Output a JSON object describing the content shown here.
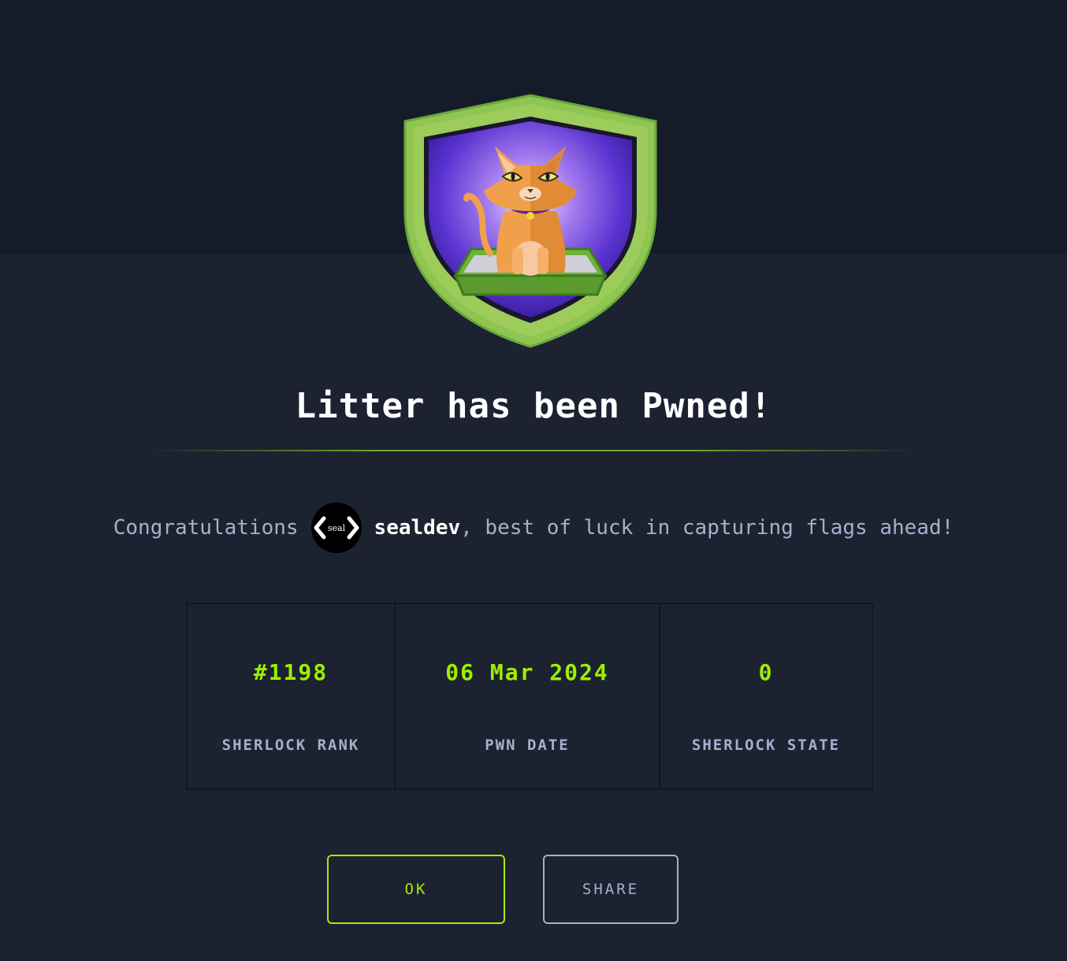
{
  "header": {
    "badge_icon": "litter-cat-shield-badge-icon"
  },
  "title": "Litter has been Pwned!",
  "congrats": {
    "prefix": "Congratulations",
    "avatar_text": "seal",
    "username": "sealdev",
    "suffix": ", best of luck in capturing flags ahead!"
  },
  "stats": [
    {
      "value": "#1198",
      "label": "SHERLOCK RANK"
    },
    {
      "value": "06 Mar 2024",
      "label": "PWN DATE"
    },
    {
      "value": "0",
      "label": "SHERLOCK STATE"
    }
  ],
  "buttons": {
    "ok": "OK",
    "share": "SHARE"
  },
  "colors": {
    "background": "#1c2230",
    "top_band": "#151b28",
    "accent_green": "#9fef00",
    "muted_text": "#a4b1cd",
    "shield_green": "#8ec553",
    "shield_purple": "#6a3fd6",
    "cat_orange": "#f0a04b"
  }
}
